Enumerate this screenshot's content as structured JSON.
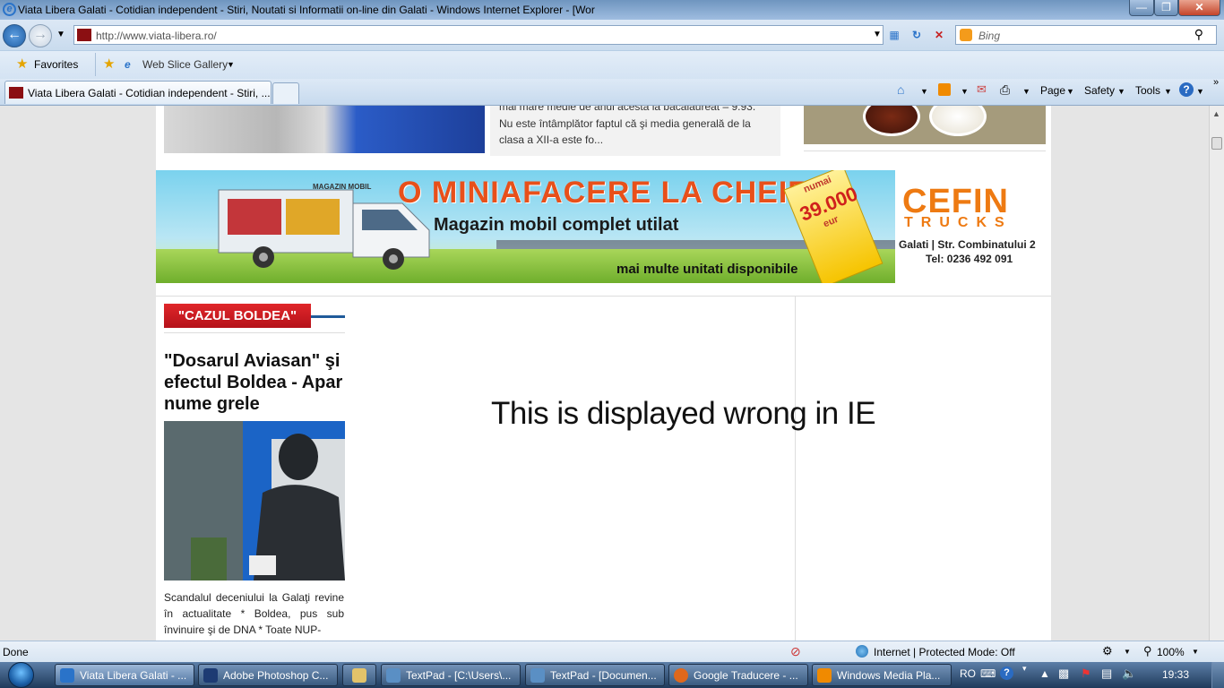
{
  "window": {
    "title": "Viata Libera Galati - Cotidian independent - Stiri, Noutati si Informatii on-line din Galati - Windows Internet Explorer - [Wor"
  },
  "address_bar": {
    "url": "http://www.viata-libera.ro/"
  },
  "search": {
    "placeholder": "Bing"
  },
  "favorites_bar": {
    "favorites_label": "Favorites",
    "web_slice_label": "Web Slice Gallery"
  },
  "tab": {
    "title": "Viata Libera Galati - Cotidian independent - Stiri, ..."
  },
  "command_bar": {
    "page_label": "Page",
    "safety_label": "Safety",
    "tools_label": "Tools"
  },
  "page": {
    "top_article_snippet_line1": "mai mare medie de anul acesta la bacalaureat – 9.93.",
    "top_article_snippet_line2": "Nu este întâmplător faptul că şi media generală de la",
    "top_article_snippet_line3": "clasa a XII-a este fo...",
    "banner": {
      "headline": "O MINIAFACERE LA CHEIE!",
      "subline": "Magazin mobil complet utilat",
      "more_units": "mai multe unitati disponibile",
      "price_prefix": "numai",
      "price": "39.000",
      "currency": "eur",
      "van_label": "MAGAZIN MOBIL",
      "brand": "CEFIN",
      "brand_sub": "TRUCKS",
      "address": "Galati | Str. Combinatului 2",
      "phone": "Tel: 0236 492 091"
    },
    "section_label": "\"CAZUL BOLDEA\"",
    "article_title": "\"Dosarul Aviasan\" şi efectul Boldea - Apar nume grele",
    "article_snippet": "Scandalul deceniului la Galaţi revine în actualitate * Boldea, pus sub învinuire şi de DNA * Toate NUP-",
    "overlay_note": "This is displayed wrong in IE"
  },
  "status_bar": {
    "status": "Done",
    "zone": "Internet | Protected Mode: Off",
    "zoom": "100%"
  },
  "taskbar": {
    "items": [
      {
        "label": "Viata Libera Galati - ...",
        "color": "#2a73c9"
      },
      {
        "label": "Adobe Photoshop C...",
        "color": "#1d3b73"
      },
      {
        "label": "TextPad - [C:\\Users\\...",
        "color": "#5a8fc4"
      },
      {
        "label": "TextPad - [Documen...",
        "color": "#5a8fc4"
      },
      {
        "label": "Google Traducere - ...",
        "color": "#e0681c"
      },
      {
        "label": "Windows Media Pla...",
        "color": "#f08a00"
      }
    ],
    "language": "RO",
    "clock": "19:33"
  }
}
